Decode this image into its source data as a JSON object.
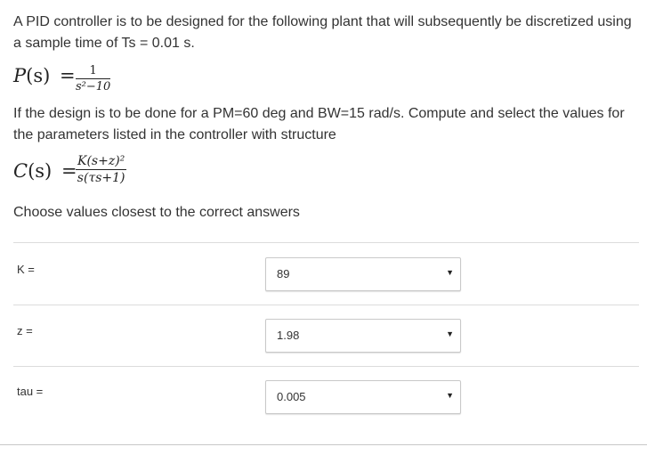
{
  "question": {
    "intro_line1": "A PID controller is to be designed for the following plant that will subsequently be discretized using",
    "intro_line2": "a sample time of Ts = 0.01 s.",
    "plant": {
      "lhs_name": "P",
      "lhs_arg": "(s)",
      "eq": "=",
      "numerator": "1",
      "denominator": "s²−10"
    },
    "spec_line1": "If the design is to be done for a PM=60 deg and BW=15 rad/s. Compute and select the values for",
    "spec_line2": "the parameters listed in the controller with structure",
    "controller": {
      "lhs_name": "C",
      "lhs_arg": "(s)",
      "eq": "=",
      "numerator": "K(s+z)²",
      "denominator": "s(τs+1)"
    },
    "instruction": "Choose values closest to the correct answers"
  },
  "fields": [
    {
      "label": "K =",
      "selected": "89"
    },
    {
      "label": "z =",
      "selected": "1.98"
    },
    {
      "label": "tau =",
      "selected": "0.005"
    }
  ]
}
